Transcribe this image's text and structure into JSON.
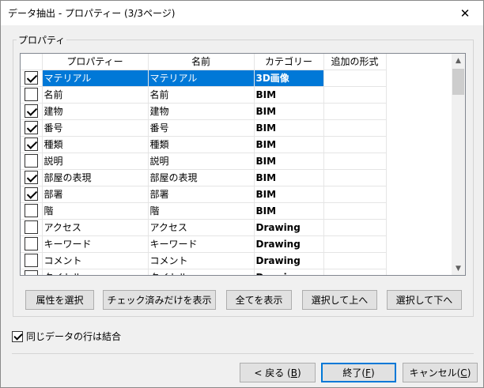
{
  "window": {
    "title": "データ抽出 - プロパティー (3/3ページ)",
    "close_glyph": "✕"
  },
  "group": {
    "label": "プロパティ"
  },
  "table": {
    "columns": [
      "",
      "プロパティー",
      "名前",
      "カテゴリー",
      "追加の形式"
    ],
    "rows": [
      {
        "checked": true,
        "property": "マテリアル",
        "name": "マテリアル",
        "category": "3D画像",
        "format": "",
        "selected": true
      },
      {
        "checked": false,
        "property": "名前",
        "name": "名前",
        "category": "BIM",
        "format": ""
      },
      {
        "checked": true,
        "property": "建物",
        "name": "建物",
        "category": "BIM",
        "format": ""
      },
      {
        "checked": true,
        "property": "番号",
        "name": "番号",
        "category": "BIM",
        "format": ""
      },
      {
        "checked": true,
        "property": "種類",
        "name": "種類",
        "category": "BIM",
        "format": ""
      },
      {
        "checked": false,
        "property": "説明",
        "name": "説明",
        "category": "BIM",
        "format": ""
      },
      {
        "checked": true,
        "property": "部屋の表現",
        "name": "部屋の表現",
        "category": "BIM",
        "format": ""
      },
      {
        "checked": true,
        "property": "部署",
        "name": "部署",
        "category": "BIM",
        "format": ""
      },
      {
        "checked": false,
        "property": "階",
        "name": "階",
        "category": "BIM",
        "format": ""
      },
      {
        "checked": false,
        "property": "アクセス",
        "name": "アクセス",
        "category": "Drawing",
        "format": ""
      },
      {
        "checked": false,
        "property": "キーワード",
        "name": "キーワード",
        "category": "Drawing",
        "format": ""
      },
      {
        "checked": false,
        "property": "コメント",
        "name": "コメント",
        "category": "Drawing",
        "format": ""
      },
      {
        "checked": false,
        "property": "タイトル",
        "name": "タイトル",
        "category": "Drawing",
        "format": ""
      }
    ]
  },
  "scrollbar": {
    "up_glyph": "▲",
    "down_glyph": "▼"
  },
  "actions": {
    "select_attributes": "属性を選択",
    "show_checked_only": "チェック済みだけを表示",
    "show_all": "全てを表示",
    "move_up": "選択して上へ",
    "move_down": "選択して下へ"
  },
  "combine": {
    "checked": true,
    "label": "同じデータの行は結合"
  },
  "footer": {
    "back": {
      "label": "< 戻る (",
      "key": "B",
      "suffix": ")"
    },
    "finish": {
      "label": "終了(",
      "key": "F",
      "suffix": ")"
    },
    "cancel": {
      "label": "キャンセル(",
      "key": "C",
      "suffix": ")"
    }
  },
  "colors": {
    "selection": "#0078d7",
    "default_button_border": "#0078d7"
  }
}
